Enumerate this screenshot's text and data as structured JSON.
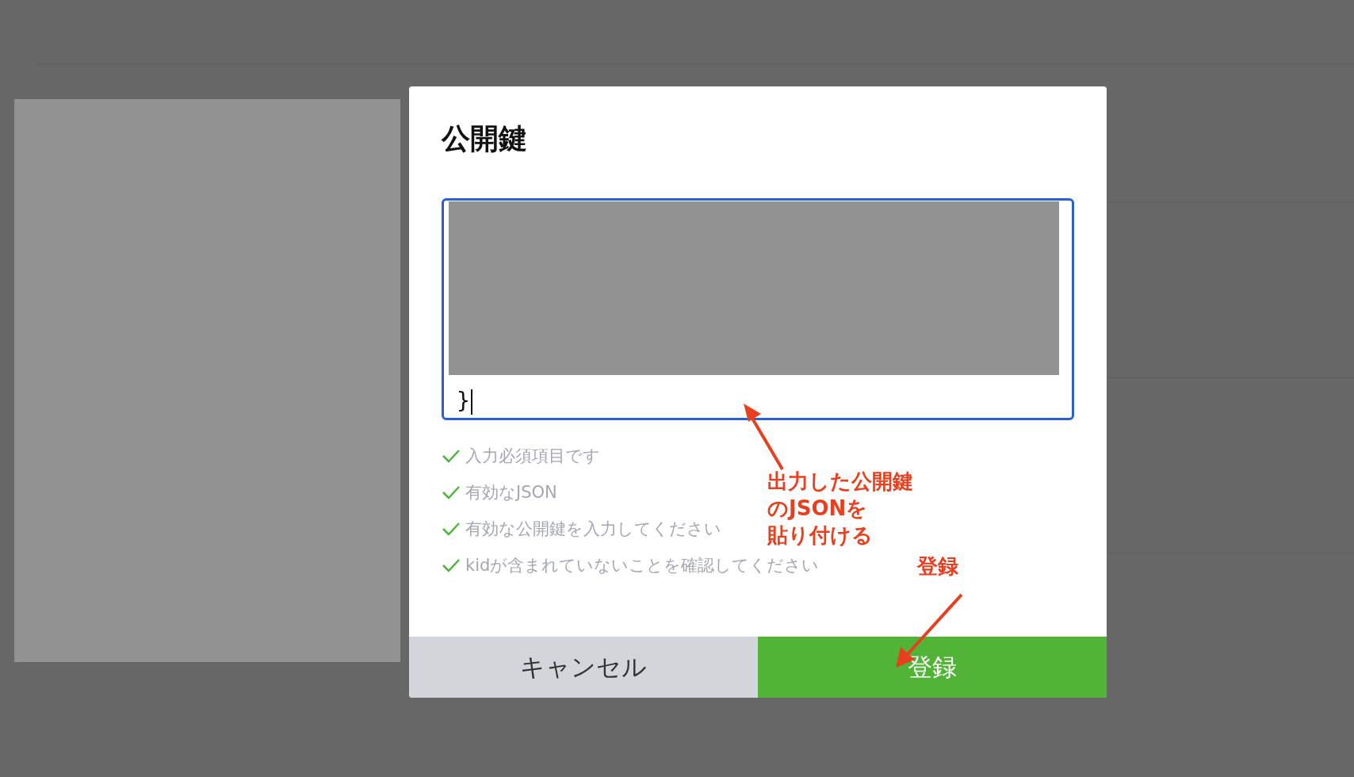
{
  "dialog": {
    "title": "公開鍵",
    "key_field": {
      "value": "}",
      "focused": true
    },
    "checks": [
      {
        "label": "入力必須項目です",
        "passed": true
      },
      {
        "label": "有効なJSON",
        "passed": true
      },
      {
        "label": "有効な公開鍵を入力してください",
        "passed": true
      },
      {
        "label": "kidが含まれていないことを確認してください",
        "passed": true
      }
    ],
    "buttons": [
      {
        "label": "キャンセル",
        "kind": "cancel"
      },
      {
        "label": "登録",
        "kind": "primary"
      }
    ]
  },
  "annotations": [
    {
      "lines": [
        "出力した公開鍵",
        "のJSONを",
        "貼り付ける"
      ],
      "kind": "field"
    },
    {
      "lines": [
        "登録"
      ],
      "kind": "button"
    }
  ]
}
